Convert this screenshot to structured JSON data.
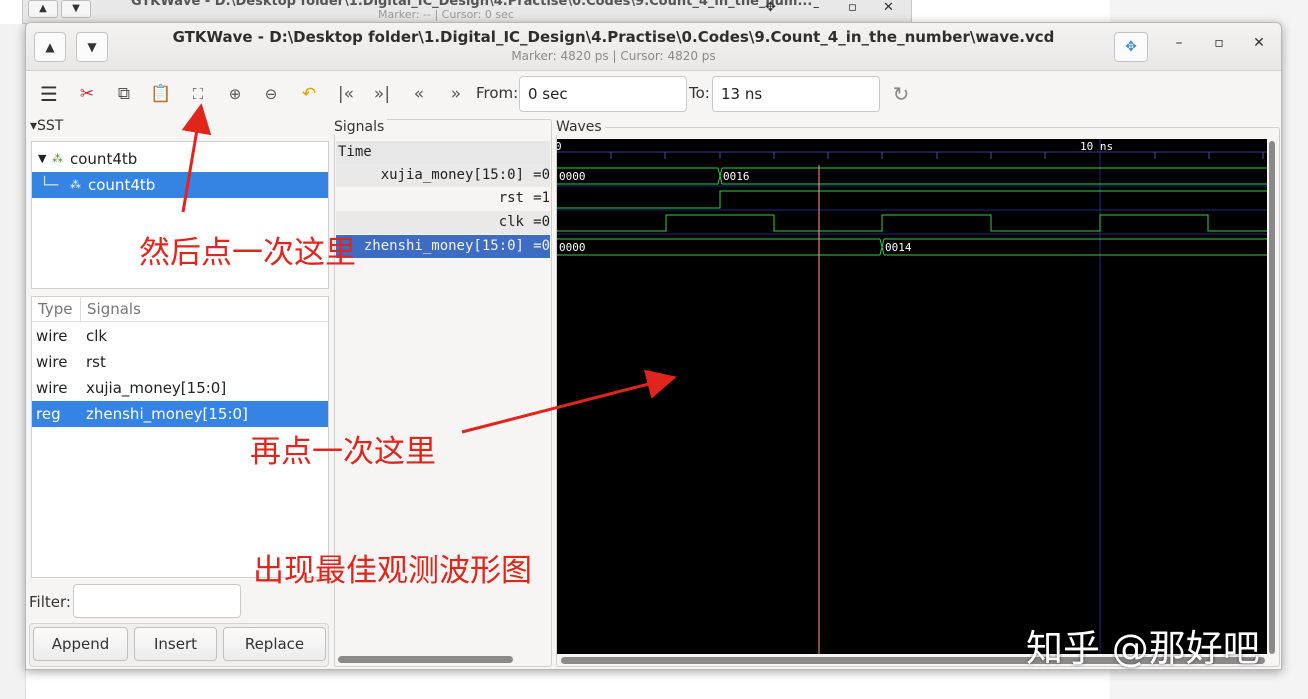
{
  "background_window": {
    "title": "GTKWave - D:\\Desktop folder\\1.Digital_IC_Design\\4.Practise\\0.Codes\\9.Count_4_in_the_num...",
    "subtitle": "Marker: --  |  Cursor: 0 sec"
  },
  "window": {
    "title": "GTKWave - D:\\Desktop folder\\1.Digital_IC_Design\\4.Practise\\0.Codes\\9.Count_4_in_the_number\\wave.vcd",
    "subtitle": "Marker: 4820 ps  |  Cursor: 4820 ps"
  },
  "toolbar": {
    "from_label": "From:",
    "from_value": "0 sec",
    "to_label": "To:",
    "to_value": "13 ns"
  },
  "sst": {
    "label": "SST",
    "tree": [
      {
        "label": "count4tb",
        "selected": false
      },
      {
        "label": "count4tb",
        "selected": true
      }
    ],
    "table": {
      "type_header": "Type",
      "signals_header": "Signals",
      "rows": [
        {
          "type": "wire",
          "name": "clk",
          "selected": false
        },
        {
          "type": "wire",
          "name": "rst",
          "selected": false
        },
        {
          "type": "wire",
          "name": "xujia_money[15:0]",
          "selected": false
        },
        {
          "type": "reg",
          "name": "zhenshi_money[15:0]",
          "selected": true
        }
      ]
    },
    "filter_label": "Filter:",
    "buttons": {
      "append": "Append",
      "insert": "Insert",
      "replace": "Replace"
    }
  },
  "signals": {
    "label": "Signals",
    "time_label": "Time",
    "rows": [
      {
        "name": "xujia_money[15:0]",
        "value": "=0"
      },
      {
        "name": "rst",
        "value": "=1"
      },
      {
        "name": "clk",
        "value": "=0"
      },
      {
        "name": "zhenshi_money[15:0]",
        "value": "=0"
      }
    ]
  },
  "waves": {
    "label": "Waves",
    "ruler_start": "0",
    "ruler_mark": "10 ns",
    "bus_values": {
      "xujia_before": "0000",
      "xujia_after": "0016",
      "zhenshi_before": "0000",
      "zhenshi_after": "0014"
    }
  },
  "annotations": {
    "note1": "然后点一次这里",
    "note2": "再点一次这里",
    "note3": "出现最佳观测波形图",
    "watermark": "知乎 @那好吧"
  },
  "colors": {
    "accent": "#3584e4",
    "wave_green": "#27c93f",
    "marker_line": "#ff9999",
    "annotation_red": "#e0261c"
  }
}
